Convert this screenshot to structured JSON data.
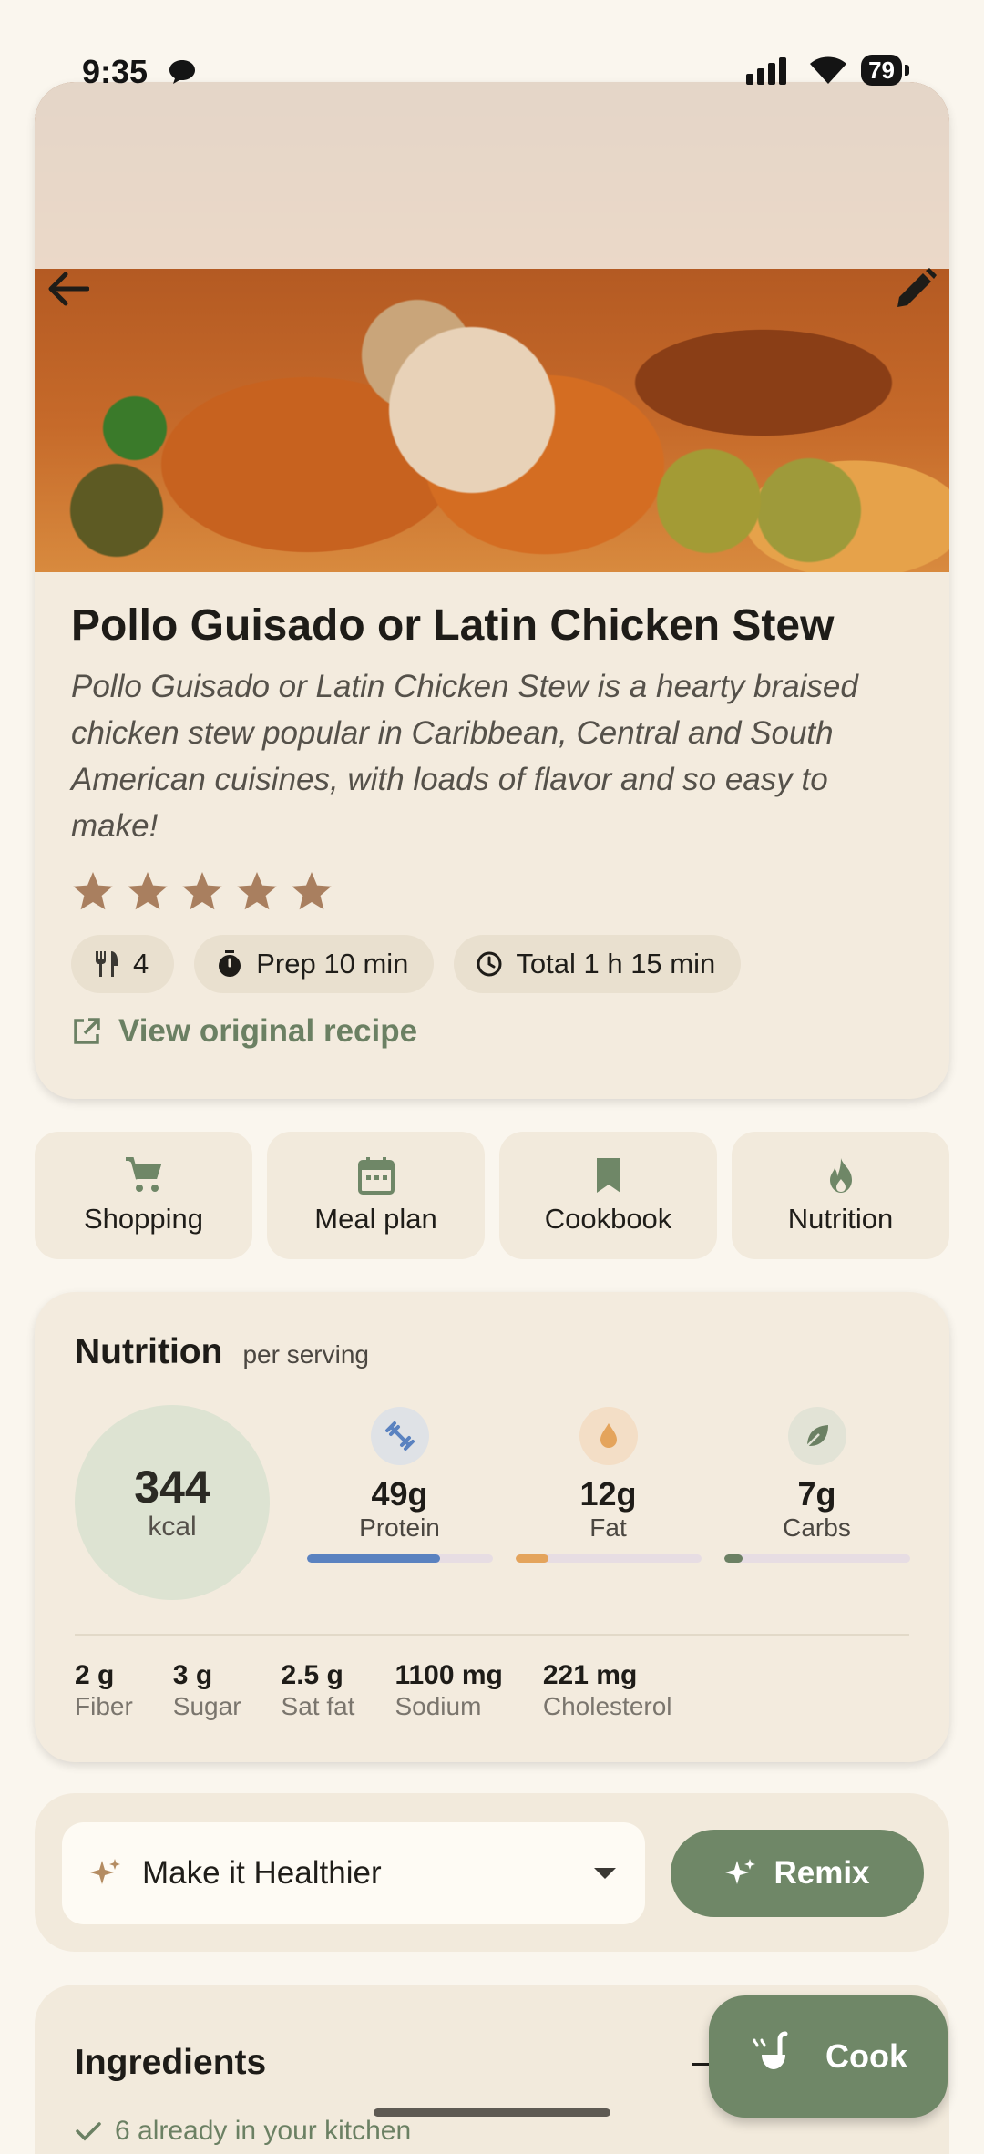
{
  "status_bar": {
    "time": "9:35",
    "battery": "79"
  },
  "recipe": {
    "title": "Pollo Guisado or Latin Chicken Stew",
    "description": "Pollo Guisado or Latin Chicken Stew is a hearty braised chicken stew popular in Caribbean, Central and South American cuisines, with loads of flavor and so easy to make!",
    "rating": 5,
    "rating_max": 5,
    "servings": "4",
    "prep": "Prep 10 min",
    "total": "Total 1 h 15 min",
    "view_original": "View original recipe"
  },
  "actions": [
    {
      "label": "Shopping",
      "icon": "cart-icon"
    },
    {
      "label": "Meal plan",
      "icon": "calendar-icon"
    },
    {
      "label": "Cookbook",
      "icon": "bookmark-icon"
    },
    {
      "label": "Nutrition",
      "icon": "flame-icon"
    }
  ],
  "nutrition": {
    "title": "Nutrition",
    "subtitle": "per serving",
    "kcal_value": "344",
    "kcal_unit": "kcal",
    "macros": [
      {
        "value": "49g",
        "name": "Protein",
        "icon": "dumbbell-icon",
        "fill_pct": 72,
        "color": "#5a82c0",
        "icon_bg": "#dfe2e6"
      },
      {
        "value": "12g",
        "name": "Fat",
        "icon": "drop-icon",
        "fill_pct": 18,
        "color": "#e4a45c",
        "icon_bg": "#f3dec6"
      },
      {
        "value": "7g",
        "name": "Carbs",
        "icon": "leaf-icon",
        "fill_pct": 10,
        "color": "#6b8063",
        "icon_bg": "#e2e3d6"
      }
    ],
    "micros": [
      {
        "value": "2 g",
        "name": "Fiber"
      },
      {
        "value": "3 g",
        "name": "Sugar"
      },
      {
        "value": "2.5 g",
        "name": "Sat fat"
      },
      {
        "value": "1100 mg",
        "name": "Sodium"
      },
      {
        "value": "221 mg",
        "name": "Cholesterol"
      }
    ]
  },
  "remix": {
    "selected": "Make it Healthier",
    "button": "Remix"
  },
  "ingredients": {
    "title": "Ingredients",
    "kitchen_note": "6 already in your kitchen"
  },
  "cook_button": "Cook",
  "colors": {
    "accent": "#6f8767",
    "star": "#a97f5f",
    "background": "#faf6ee"
  }
}
